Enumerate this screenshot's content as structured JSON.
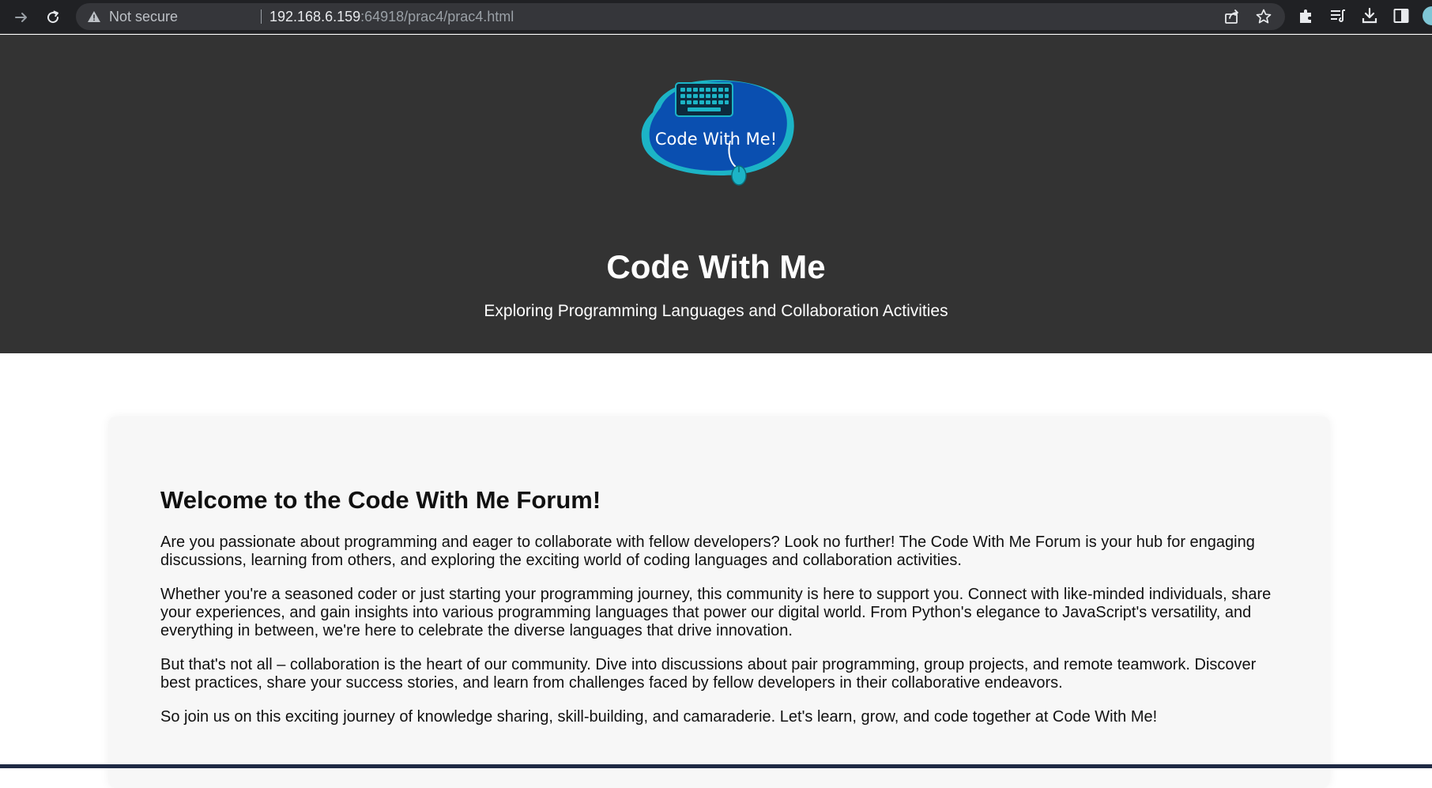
{
  "browser": {
    "security_label": "Not secure",
    "url_host": "192.168.6.159",
    "url_path": ":64918/prac4/prac4.html"
  },
  "header": {
    "logo_text": "Code With Me!",
    "title": "Code With Me",
    "subtitle": "Exploring Programming Languages and Collaboration Activities"
  },
  "main": {
    "heading": "Welcome to the Code With Me Forum!",
    "paragraphs": [
      "Are you passionate about programming and eager to collaborate with fellow developers? Look no further! The Code With Me Forum is your hub for engaging discussions, learning from others, and exploring the exciting world of coding languages and collaboration activities.",
      "Whether you're a seasoned coder or just starting your programming journey, this community is here to support you. Connect with like-minded individuals, share your experiences, and gain insights into various programming languages that power our digital world. From Python's elegance to JavaScript's versatility, and everything in between, we're here to celebrate the diverse languages that drive innovation.",
      "But that's not all – collaboration is the heart of our community. Dive into discussions about pair programming, group projects, and remote teamwork. Discover best practices, share your success stories, and learn from challenges faced by fellow developers in their collaborative endeavors.",
      "So join us on this exciting journey of knowledge sharing, skill-building, and camaraderie. Let's learn, grow, and code together at Code With Me!"
    ]
  },
  "colors": {
    "browser_bar": "#202124",
    "header_bg": "#333333",
    "card_bg": "#f7f7f7",
    "logo_blue": "#0a4fb0",
    "logo_teal": "#1cb4c6"
  },
  "icons": {
    "forward": "forward-arrow-icon",
    "reload": "reload-icon",
    "warning": "warning-triangle-icon",
    "share": "share-icon",
    "bookmark": "star-icon",
    "extensions": "puzzle-icon",
    "reading_list": "reading-list-icon",
    "download": "download-icon",
    "side_panel": "side-panel-icon"
  }
}
